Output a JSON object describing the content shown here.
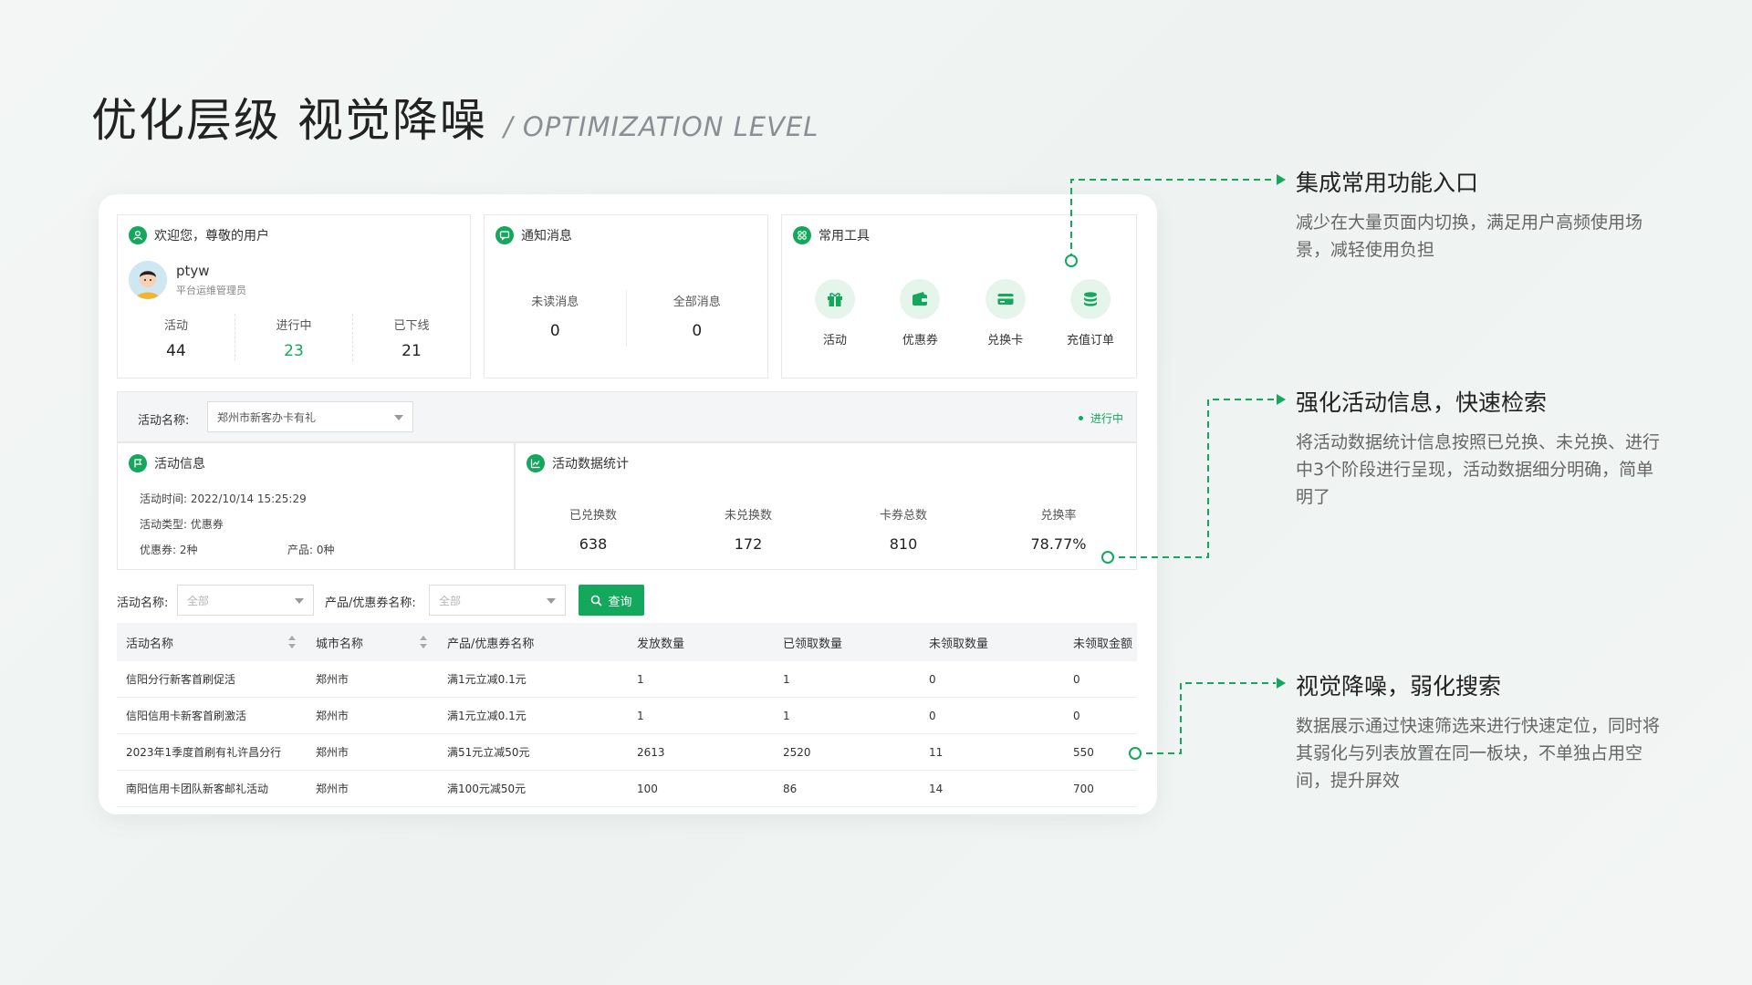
{
  "header": {
    "title": "优化层级 视觉降噪",
    "subtitle": "/ OPTIMIZATION LEVEL"
  },
  "welcome": {
    "title": "欢迎您，尊敬的用户",
    "username": "ptyw",
    "role": "平台运维管理员",
    "stats": [
      {
        "label": "活动",
        "value": "44"
      },
      {
        "label": "进行中",
        "value": "23"
      },
      {
        "label": "已下线",
        "value": "21"
      }
    ]
  },
  "notice": {
    "title": "通知消息",
    "stats": [
      {
        "label": "未读消息",
        "value": "0"
      },
      {
        "label": "全部消息",
        "value": "0"
      }
    ]
  },
  "tools": {
    "title": "常用工具",
    "items": [
      {
        "label": "活动",
        "icon": "gift-icon"
      },
      {
        "label": "优惠券",
        "icon": "wallet-icon"
      },
      {
        "label": "兑换卡",
        "icon": "card-icon"
      },
      {
        "label": "充值订单",
        "icon": "coins-icon"
      }
    ]
  },
  "activity_filter": {
    "label": "活动名称:",
    "value": "郑州市新客办卡有礼",
    "status": "进行中"
  },
  "activity_info": {
    "title": "活动信息",
    "time": "活动时间: 2022/10/14 15:25:29",
    "type": "活动类型: 优惠券",
    "coupons": "优惠券: 2种",
    "products": "产品: 0种"
  },
  "activity_stats": {
    "title": "活动数据统计",
    "stats": [
      {
        "label": "已兑换数",
        "value": "638"
      },
      {
        "label": "未兑换数",
        "value": "172"
      },
      {
        "label": "卡券总数",
        "value": "810"
      },
      {
        "label": "兑换率",
        "value": "78.77%"
      }
    ]
  },
  "search": {
    "label1": "活动名称:",
    "sel1": "全部",
    "label2": "产品/优惠券名称:",
    "sel2": "全部",
    "button": "查询"
  },
  "table": {
    "headers": [
      "活动名称",
      "城市名称",
      "产品/优惠券名称",
      "发放数量",
      "已领取数量",
      "未领取数量",
      "未领取金额"
    ],
    "rows": [
      [
        "信阳分行新客首刷促活",
        "郑州市",
        "满1元立减0.1元",
        "1",
        "1",
        "0",
        "0"
      ],
      [
        "信阳信用卡新客首刷激活",
        "郑州市",
        "满1元立减0.1元",
        "1",
        "1",
        "0",
        "0"
      ],
      [
        "2023年1季度首刷有礼许昌分行",
        "郑州市",
        "满51元立减50元",
        "2613",
        "2520",
        "11",
        "550"
      ],
      [
        "南阳信用卡团队新客邮礼活动",
        "郑州市",
        "满100元减50元",
        "100",
        "86",
        "14",
        "700"
      ]
    ]
  },
  "annotations": [
    {
      "title": "集成常用功能入口",
      "text": "减少在大量页面内切换，满足用户高频使用场景，减轻使用负担"
    },
    {
      "title": "强化活动信息，快速检索",
      "text": "将活动数据统计信息按照已兑换、未兑换、进行中3个阶段进行呈现，活动数据细分明确，简单明了"
    },
    {
      "title": "视觉降噪，弱化搜索",
      "text": "数据展示通过快速筛选来进行快速定位，同时将其弱化与列表放置在同一板块，不单独占用空间，提升屏效"
    }
  ],
  "colors": {
    "accent": "#14a85d",
    "background": "#f1f5f3"
  }
}
